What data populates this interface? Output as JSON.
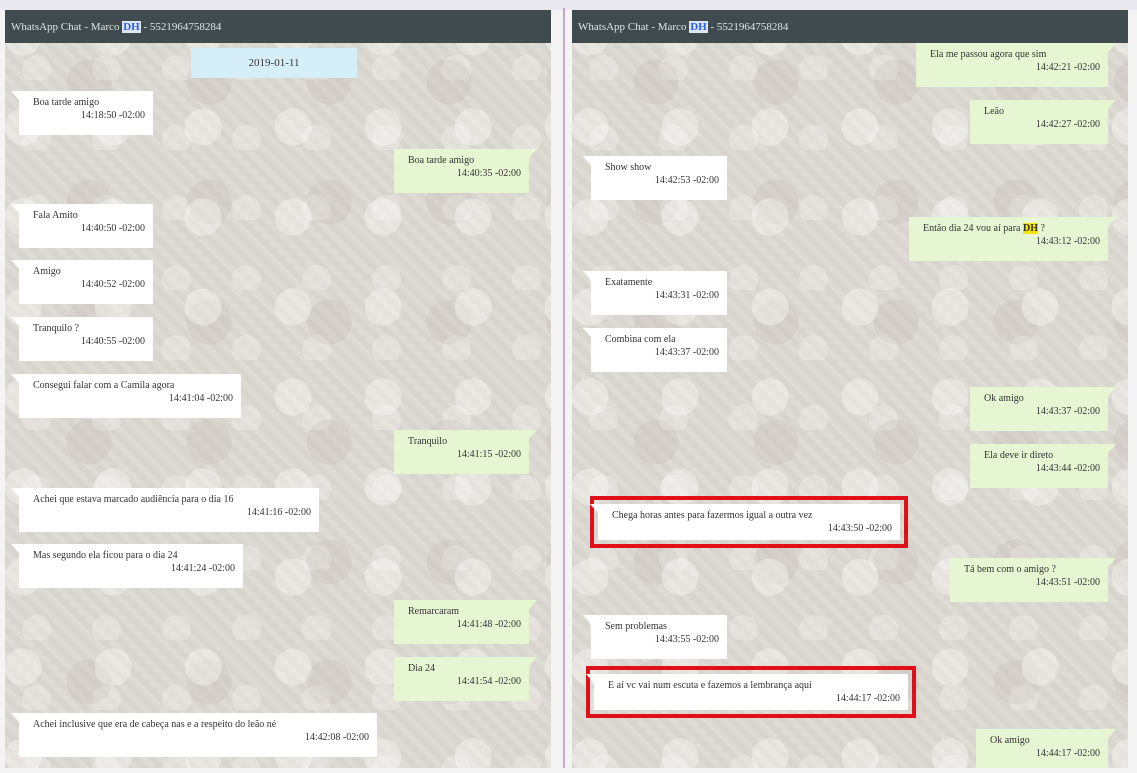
{
  "left_chat": {
    "header": {
      "prefix": "WhatsApp Chat - Marco ",
      "highlight": "DH",
      "suffix": " - 5521964758284"
    },
    "date_badge": "2019-01-11",
    "messages": [
      {
        "text": "Boa tarde amigo",
        "time": "14:18:50 -02:00"
      },
      {
        "text": "Boa tarde amigo",
        "time": "14:40:35 -02:00"
      },
      {
        "text": "Fala Amito",
        "time": "14:40:50 -02:00"
      },
      {
        "text": "Amigo",
        "time": "14:40:52 -02:00"
      },
      {
        "text": "Tranquilo ?",
        "time": "14:40:55 -02:00"
      },
      {
        "text": "Consegui falar com a Camila agora",
        "time": "14:41:04 -02:00"
      },
      {
        "text": "Tranquilo",
        "time": "14:41:15 -02:00"
      },
      {
        "text": "Achei que estava marcado audiência para o dia 16",
        "time": "14:41:16 -02:00"
      },
      {
        "text": "Mas segundo ela ficou para o dia 24",
        "time": "14:41:24 -02:00"
      },
      {
        "text": "Remarcaram",
        "time": "14:41:48 -02:00"
      },
      {
        "text": "Dia 24",
        "time": "14:41:54 -02:00"
      },
      {
        "text": "Achei inclusive que era de cabeça nas e a respeito do leão né",
        "time": "14:42:08 -02:00"
      }
    ]
  },
  "right_chat": {
    "header": {
      "prefix": "WhatsApp Chat - Marco ",
      "highlight": "DH",
      "suffix": " - 5521964758284"
    },
    "messages": [
      {
        "text": "Ela me passou agora que sim",
        "time": "14:42:21 -02:00"
      },
      {
        "text": "Leão",
        "time": "14:42:27 -02:00"
      },
      {
        "text": "Show show",
        "time": "14:42:53 -02:00"
      },
      {
        "text_before": "Então dia 24 vou aí para ",
        "text_highlight": "DH",
        "text_after": " ?",
        "time": "14:43:12 -02:00"
      },
      {
        "text": "Exatamente",
        "time": "14:43:31 -02:00"
      },
      {
        "text": "Combina com ela",
        "time": "14:43:37 -02:00"
      },
      {
        "text": "Ok amigo",
        "time": "14:43:37 -02:00"
      },
      {
        "text": "Ela deve ir direto",
        "time": "14:43:44 -02:00"
      },
      {
        "text": "Chega horas antes para fazermos igual a outra vez",
        "time": "14:43:50 -02:00"
      },
      {
        "text": "Tá bem com o amigo ?",
        "time": "14:43:51 -02:00"
      },
      {
        "text": "Sem problemas",
        "time": "14:43:55 -02:00"
      },
      {
        "text": "E aí vc vai num escuta e fazemos a lembrança aqui",
        "time": "14:44:17 -02:00"
      },
      {
        "text": "Ok amigo",
        "time": "14:44:17 -02:00"
      }
    ]
  }
}
